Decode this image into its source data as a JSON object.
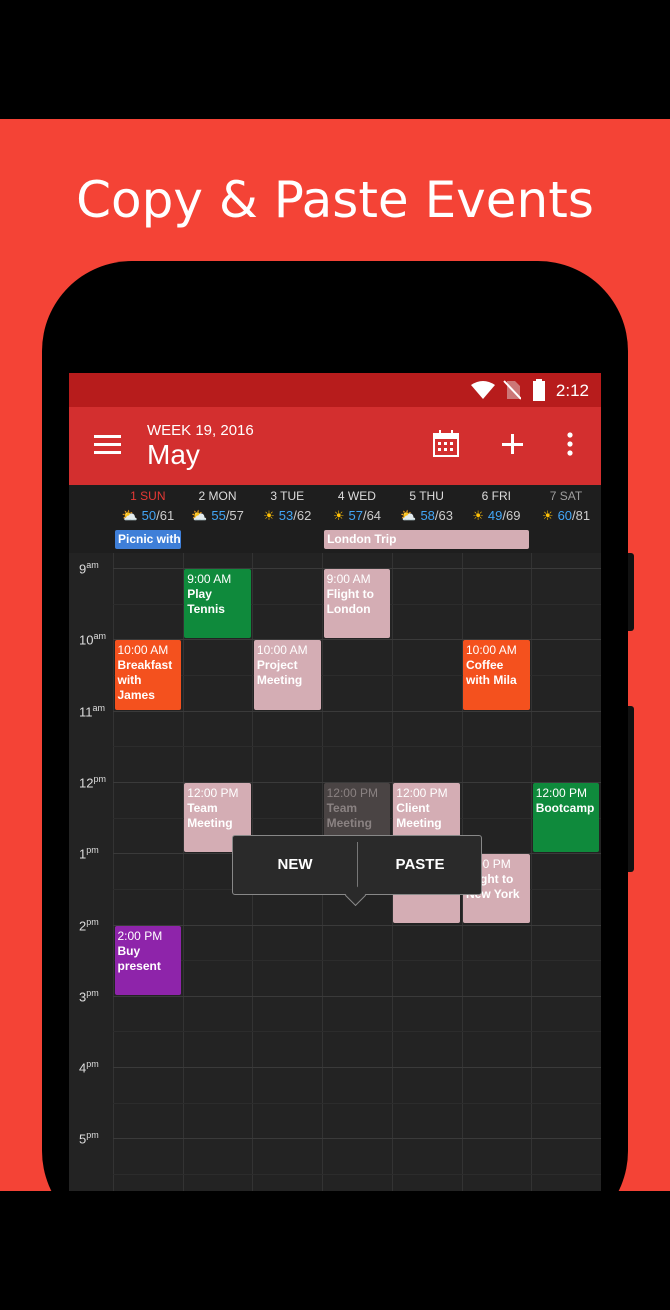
{
  "promo_title": "Copy & Paste Events",
  "status": {
    "time": "2:12"
  },
  "appbar": {
    "week": "WEEK 19, 2016",
    "month": "May",
    "icons": [
      "menu-icon",
      "calendar-icon",
      "add-icon",
      "more-vert-icon"
    ]
  },
  "days": [
    {
      "label": "1 SUN",
      "icon": "partly-cloudy",
      "hi": "50",
      "lo": "/61",
      "color": "#e53935"
    },
    {
      "label": "2 MON",
      "icon": "partly-cloudy",
      "hi": "55",
      "lo": "/57",
      "color": "#dddddd"
    },
    {
      "label": "3 TUE",
      "icon": "sunny",
      "hi": "53",
      "lo": "/62",
      "color": "#dddddd"
    },
    {
      "label": "4 WED",
      "icon": "sunny",
      "hi": "57",
      "lo": "/64",
      "color": "#dddddd"
    },
    {
      "label": "5 THU",
      "icon": "partly-cloudy",
      "hi": "58",
      "lo": "/63",
      "color": "#dddddd"
    },
    {
      "label": "6 FRI",
      "icon": "sunny",
      "hi": "49",
      "lo": "/69",
      "color": "#dddddd"
    },
    {
      "label": "7 SAT",
      "icon": "sunny",
      "hi": "60",
      "lo": "/81",
      "color": "#9e9e9e"
    }
  ],
  "allday": [
    {
      "name": "Picnic with",
      "day": 0,
      "span": 1,
      "color": "#3f7fd8"
    },
    {
      "name": "London Trip",
      "day": 3,
      "span": 3,
      "color": "#d4adb4"
    }
  ],
  "hours": [
    {
      "h": "9",
      "ap": "am"
    },
    {
      "h": "10",
      "ap": "am"
    },
    {
      "h": "11",
      "ap": "am"
    },
    {
      "h": "12",
      "ap": "pm"
    },
    {
      "h": "1",
      "ap": "pm"
    },
    {
      "h": "2",
      "ap": "pm"
    },
    {
      "h": "3",
      "ap": "pm"
    },
    {
      "h": "4",
      "ap": "pm"
    },
    {
      "h": "5",
      "ap": "pm"
    }
  ],
  "events": [
    {
      "time": "9:00 AM",
      "name": "Play Tennis",
      "day": 1,
      "start": 9,
      "dur": 1,
      "color": "#0f8a3c"
    },
    {
      "time": "9:00 AM",
      "name": "Flight to London",
      "day": 3,
      "start": 9,
      "dur": 1,
      "color": "#d4adb4"
    },
    {
      "time": "10:00 AM",
      "name": "Breakfast with James",
      "day": 0,
      "start": 10,
      "dur": 1,
      "color": "#f4511e"
    },
    {
      "time": "10:00 AM",
      "name": "Project Meeting",
      "day": 2,
      "start": 10,
      "dur": 1,
      "color": "#d4adb4"
    },
    {
      "time": "10:00 AM",
      "name": "Coffee with Mila",
      "day": 5,
      "start": 10,
      "dur": 1,
      "color": "#f4511e"
    },
    {
      "time": "12:00 PM",
      "name": "Team Meeting",
      "day": 1,
      "start": 12,
      "dur": 1,
      "color": "#d4adb4"
    },
    {
      "time": "12:00 PM",
      "name": "Team Meeting",
      "day": 3,
      "start": 12,
      "dur": 1,
      "color": "#4a4444",
      "ghost": true
    },
    {
      "time": "12:00 PM",
      "name": "Client Meeting",
      "day": 4,
      "start": 12,
      "dur": 2,
      "color": "#d4adb4"
    },
    {
      "time": "12:00 PM",
      "name": "Bootcamp",
      "day": 6,
      "start": 12,
      "dur": 1,
      "color": "#0f8a3c"
    },
    {
      "time": "1:00 PM",
      "name": "Flight to New York",
      "day": 5,
      "start": 13,
      "dur": 1,
      "color": "#d4adb4"
    },
    {
      "time": "2:00 PM",
      "name": "Buy present",
      "day": 0,
      "start": 14,
      "dur": 1,
      "color": "#8e24aa"
    }
  ],
  "popup": {
    "new_label": "NEW",
    "paste_label": "PASTE"
  }
}
